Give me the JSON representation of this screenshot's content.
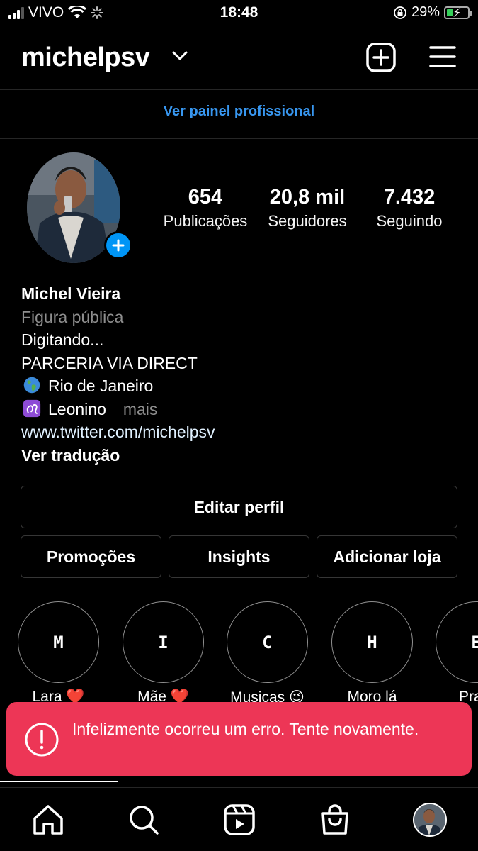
{
  "status_bar": {
    "carrier": "VIVO",
    "time": "18:48",
    "battery_percent": "29%",
    "battery_level": 0.29,
    "icons": [
      "signal-icon",
      "wifi-icon",
      "loading-icon",
      "orientation-lock-icon",
      "battery-icon"
    ]
  },
  "header": {
    "username": "michelpsv",
    "icons": [
      "chevron-down-icon",
      "add-post-icon",
      "menu-icon"
    ]
  },
  "pro_panel": "Ver painel profissional",
  "stats": {
    "posts": {
      "value": "654",
      "label": "Publicações"
    },
    "followers": {
      "value": "20,8 mil",
      "label": "Seguidores"
    },
    "following": {
      "value": "7.432",
      "label": "Seguindo"
    }
  },
  "bio": {
    "name": "Michel Vieira",
    "category": "Figura pública",
    "line1": "Digitando...",
    "line2": "PARCERIA VIA DIRECT",
    "location": "Rio de Janeiro",
    "location_emoji": "globe-icon",
    "sign": "Leonino",
    "sign_emoji": "leo-icon",
    "more": "mais",
    "link": "www.twitter.com/michelpsv",
    "translate": "Ver tradução"
  },
  "buttons": {
    "edit_profile": "Editar perfil",
    "promotions": "Promoções",
    "insights": "Insights",
    "add_shop": "Adicionar loja"
  },
  "highlights": [
    {
      "letter": "M",
      "label": "Lara ❤️"
    },
    {
      "letter": "I",
      "label": "Mãe ❤️"
    },
    {
      "letter": "C",
      "label": "Musicas 😉"
    },
    {
      "letter": "H",
      "label": "Moro lá"
    },
    {
      "letter": "E",
      "label": "Praia"
    }
  ],
  "toast": {
    "message": "Infelizmente ocorreu um erro. Tente novamente.",
    "color": "#ed3656"
  },
  "nav": [
    "home-icon",
    "search-icon",
    "reels-icon",
    "shop-icon",
    "profile-avatar"
  ],
  "colors": {
    "accent": "#0095f6",
    "link": "#3897f0"
  }
}
